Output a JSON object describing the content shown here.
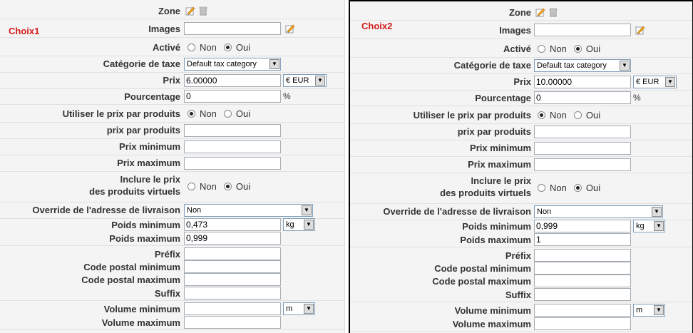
{
  "panels": [
    {
      "choix": "Choix1",
      "labels": {
        "zone": "Zone",
        "images": "Images",
        "active": "Activé",
        "tax": "Catégorie de taxe",
        "price": "Prix",
        "percent": "Pourcentage",
        "use_product_price": "Utiliser le prix par produits",
        "price_per_product": "prix par produits",
        "price_min": "Prix minimum",
        "price_max": "Prix maximum",
        "include_virtual_1": "Inclure le prix",
        "include_virtual_2": "des produits virtuels",
        "override_address": "Override de l'adresse de livraison",
        "weight_min": "Poids minimum",
        "weight_max": "Poids maximum",
        "prefix": "Préfix",
        "postal_min": "Code postal minimum",
        "postal_max": "Code postal maximum",
        "suffix": "Suffix",
        "volume_min": "Volume minimum",
        "volume_max": "Volume maximum"
      },
      "non": "Non",
      "oui": "Oui",
      "percent_sign": "%",
      "active_selected": "Oui",
      "use_product_price_selected": "Non",
      "include_virtual_selected": "Oui",
      "tax_value": "Default tax category",
      "price_value": "6.00000",
      "currency": "€ EUR",
      "percent_value": "0",
      "price_per_product_value": "",
      "price_min_value": "",
      "price_max_value": "",
      "override_value": "Non",
      "weight_min_value": "0,473",
      "weight_unit": "kg",
      "weight_max_value": "0,999",
      "prefix_value": "",
      "postal_min_value": "",
      "postal_max_value": "",
      "suffix_value": "",
      "volume_min_value": "",
      "volume_unit": "m",
      "volume_max_value": ""
    },
    {
      "choix": "Choix2",
      "labels": {
        "zone": "Zone",
        "images": "Images",
        "active": "Activé",
        "tax": "Catégorie de taxe",
        "price": "Prix",
        "percent": "Pourcentage",
        "use_product_price": "Utiliser le prix par produits",
        "price_per_product": "prix par produits",
        "price_min": "Prix minimum",
        "price_max": "Prix maximum",
        "include_virtual_1": "Inclure le prix",
        "include_virtual_2": "des produits virtuels",
        "override_address": "Override de l'adresse de livraison",
        "weight_min": "Poids minimum",
        "weight_max": "Poids maximum",
        "prefix": "Préfix",
        "postal_min": "Code postal minimum",
        "postal_max": "Code postal maximum",
        "suffix": "Suffix",
        "volume_min": "Volume minimum",
        "volume_max": "Volume maximum"
      },
      "non": "Non",
      "oui": "Oui",
      "percent_sign": "%",
      "active_selected": "Oui",
      "use_product_price_selected": "Non",
      "include_virtual_selected": "Oui",
      "tax_value": "Default tax category",
      "price_value": "10.00000",
      "currency": "€ EUR",
      "percent_value": "0",
      "price_per_product_value": "",
      "price_min_value": "",
      "price_max_value": "",
      "override_value": "Non",
      "weight_min_value": "0,999",
      "weight_unit": "kg",
      "weight_max_value": "1",
      "prefix_value": "",
      "postal_min_value": "",
      "postal_max_value": "",
      "suffix_value": "",
      "volume_min_value": "",
      "volume_unit": "m",
      "volume_max_value": ""
    }
  ],
  "colors": {
    "choix_label": "#d41b1b",
    "panel_bg": "#f4f4f4"
  },
  "icons": {
    "edit": "edit-icon",
    "delete": "trash-icon",
    "image_edit": "edit-icon"
  }
}
